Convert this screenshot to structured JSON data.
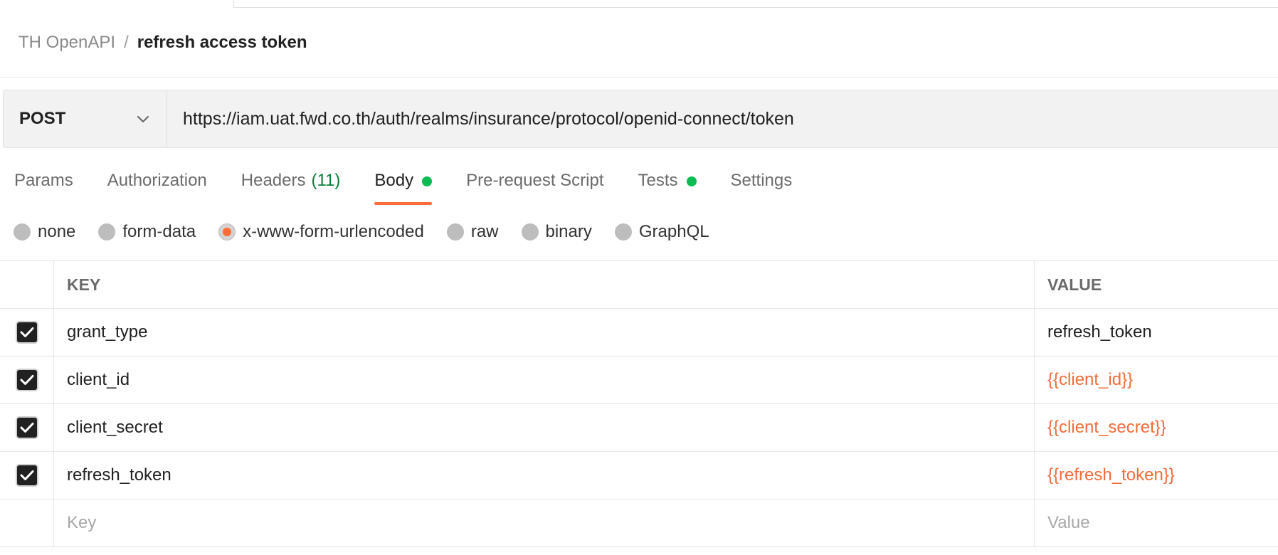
{
  "breadcrumb": {
    "collection": "TH OpenAPI",
    "separator": "/",
    "request_name": "refresh access token"
  },
  "request": {
    "method": "POST",
    "url": "https://iam.uat.fwd.co.th/auth/realms/insurance/protocol/openid-connect/token"
  },
  "tabs": [
    {
      "label": "Params"
    },
    {
      "label": "Authorization"
    },
    {
      "label": "Headers",
      "count": "(11)"
    },
    {
      "label": "Body",
      "active": true,
      "indicator": true
    },
    {
      "label": "Pre-request Script"
    },
    {
      "label": "Tests",
      "indicator": true
    },
    {
      "label": "Settings"
    }
  ],
  "body_types": [
    {
      "label": "none"
    },
    {
      "label": "form-data"
    },
    {
      "label": "x-www-form-urlencoded",
      "selected": true
    },
    {
      "label": "raw"
    },
    {
      "label": "binary"
    },
    {
      "label": "GraphQL"
    }
  ],
  "table": {
    "headers": {
      "key": "KEY",
      "value": "VALUE"
    },
    "rows": [
      {
        "checked": true,
        "key": "grant_type",
        "value": "refresh_token"
      },
      {
        "checked": true,
        "key": "client_id",
        "value": "{{client_id}}"
      },
      {
        "checked": true,
        "key": "client_secret",
        "value": "{{client_secret}}"
      },
      {
        "checked": true,
        "key": "refresh_token",
        "value": "{{refresh_token}}"
      }
    ],
    "new_row": {
      "key_placeholder": "Key",
      "value_placeholder": "Value"
    }
  },
  "colors": {
    "accent": "#ff6c37",
    "indicator_green": "#0cbb52",
    "count_green": "#0a7d3a",
    "variable": "#f26b3a"
  }
}
